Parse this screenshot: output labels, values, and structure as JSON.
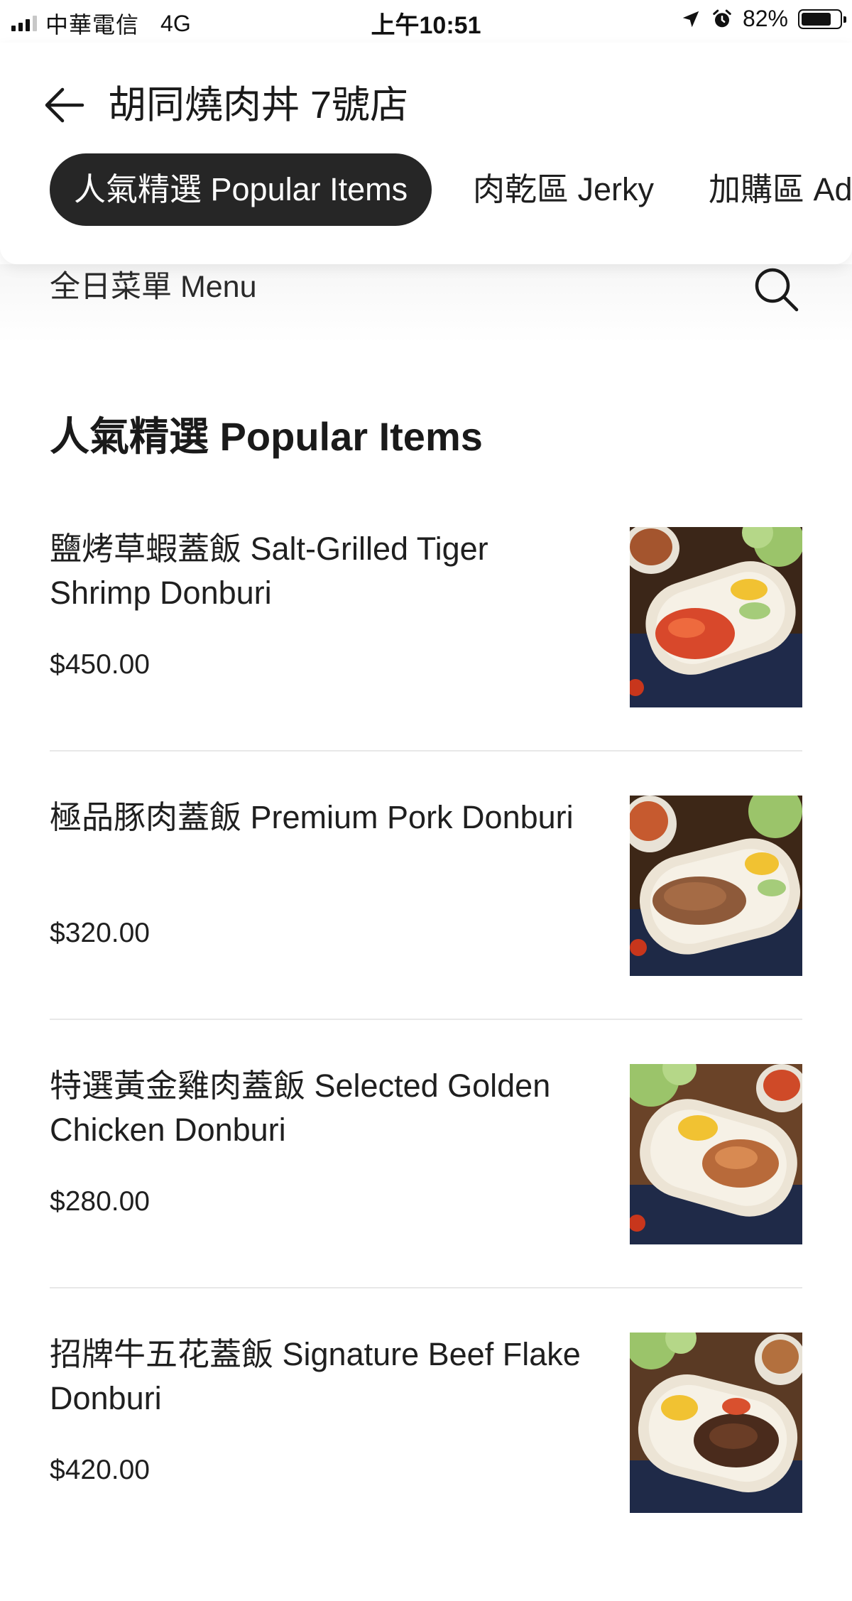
{
  "status_bar": {
    "carrier": "中華電信",
    "network": "4G",
    "time": "上午10:51",
    "battery_text": "82%",
    "battery_level": 0.82,
    "icons": [
      "signal-icon",
      "location-arrow-icon",
      "alarm-icon",
      "battery-icon"
    ]
  },
  "header": {
    "store_name": "胡同燒肉丼 7號店",
    "back_icon": "arrow-left-icon"
  },
  "tabs": [
    {
      "label": "人氣精選 Popular Items",
      "active": true
    },
    {
      "label": "肉乾區 Jerky",
      "active": false
    },
    {
      "label": "加購區 Ad",
      "active": false
    }
  ],
  "subheader": {
    "menu_label": "全日菜單 Menu",
    "search_icon": "search-icon"
  },
  "section": {
    "title": "人氣精選 Popular Items",
    "items": [
      {
        "name": "鹽烤草蝦蓋飯 Salt-Grilled Tiger Shrimp Donburi",
        "price": "$450.00",
        "image": "shrimp-donburi-photo"
      },
      {
        "name": "極品豚肉蓋飯 Premium Pork Donburi",
        "price": "$320.00",
        "image": "pork-donburi-photo"
      },
      {
        "name": "特選黃金雞肉蓋飯 Selected Golden Chicken Donburi",
        "price": "$280.00",
        "image": "chicken-donburi-photo"
      },
      {
        "name": "招牌牛五花蓋飯 Signature Beef Flake Donburi",
        "price": "$420.00",
        "image": "beef-donburi-photo"
      }
    ]
  },
  "colors": {
    "active_tab_bg": "#262626",
    "active_tab_text": "#ffffff",
    "text": "#1f1f1f",
    "divider": "#e8e8e8"
  }
}
